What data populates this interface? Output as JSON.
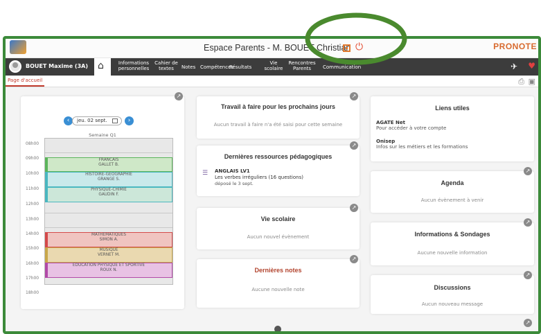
{
  "header": {
    "title": "Espace Parents - M. BOUET Christian",
    "brand": "PRONOTE"
  },
  "nav": {
    "user": "BOUET Maxime (3A)",
    "items": [
      {
        "label": "Informations personnelles"
      },
      {
        "label": "Cahier de textes"
      },
      {
        "label": "Notes"
      },
      {
        "label": "Compétences"
      },
      {
        "label": "Résultats"
      },
      {
        "label": "Vie scolaire"
      },
      {
        "label": "Rencontres Parents"
      },
      {
        "label": "Communication"
      }
    ]
  },
  "breadcrumb": {
    "label": "Page d'accueil"
  },
  "timetable": {
    "date": "jeu. 02 sept.",
    "week": "Semaine Q1",
    "hours": [
      "08h00",
      "09h00",
      "10h00",
      "11h00",
      "12h00",
      "13h00",
      "14h00",
      "15h00",
      "16h00",
      "17h00",
      "18h00"
    ],
    "lessons": [
      {
        "subject": "FRANCAIS",
        "teacher": "GALLET B.",
        "color": "#5bb55b",
        "bg": "#cfe8c8"
      },
      {
        "subject": "HISTOIRE-GEOGRAPHIE",
        "teacher": "GRANGE S.",
        "color": "#4ab7c0",
        "bg": "#c9e9ea"
      },
      {
        "subject": "PHYSIQUE-CHIMIE",
        "teacher": "GAUDIN F.",
        "color": "#4ab7c0",
        "bg": "#cce7d9"
      },
      {
        "subject": "MATHEMATIQUES",
        "teacher": "SIMON A.",
        "color": "#d44a4a",
        "bg": "#f0c4c0"
      },
      {
        "subject": "MUSIQUE",
        "teacher": "VERNET M.",
        "color": "#c9a84a",
        "bg": "#ead9b0"
      },
      {
        "subject": "EDUCATION PHYSIQUE ET SPORTIVE",
        "teacher": "ROUX N.",
        "color": "#b24aa8",
        "bg": "#e8c2e4"
      }
    ]
  },
  "cards": {
    "travail": {
      "title": "Travail à faire pour les prochains jours",
      "empty": "Aucun travail à faire n'a été saisi pour cette semaine"
    },
    "ressources": {
      "title": "Dernières ressources pédagogiques",
      "item_title": "ANGLAIS LV1",
      "item_desc": "Les verbes irréguliers (16 questions)",
      "item_date": "déposé le 3 sept."
    },
    "vie": {
      "title": "Vie scolaire",
      "empty": "Aucun nouvel évènement"
    },
    "notes": {
      "title": "Dernières notes",
      "empty": "Aucune nouvelle note"
    },
    "liens": {
      "title": "Liens utiles",
      "links": [
        {
          "name": "AGATE Net",
          "desc": "Pour accéder à votre compte"
        },
        {
          "name": "Onisep",
          "desc": "Infos sur les métiers et les formations"
        }
      ]
    },
    "agenda": {
      "title": "Agenda",
      "empty": "Aucun évènement à venir"
    },
    "infos": {
      "title": "Informations & Sondages",
      "empty": "Aucune nouvelle information"
    },
    "discussions": {
      "title": "Discussions",
      "empty": "Aucun nouveau message"
    }
  }
}
